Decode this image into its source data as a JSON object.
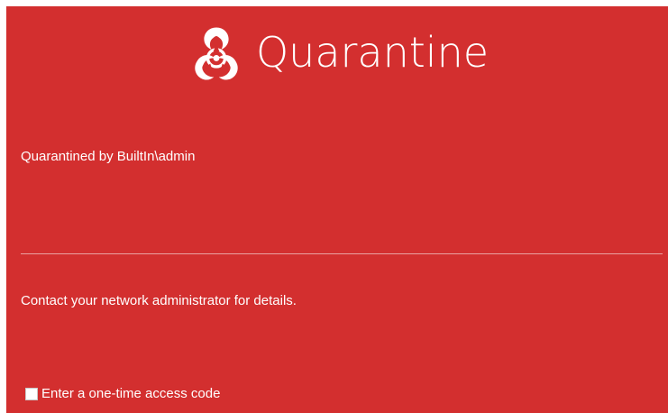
{
  "header": {
    "icon": "biohazard-icon",
    "title": "Quarantine"
  },
  "status": {
    "quarantined_by": "Quarantined by BuiltIn\\admin"
  },
  "message": {
    "contact": "Contact your network administrator for details."
  },
  "access_code": {
    "label": "Enter a one-time access code",
    "checked": false
  },
  "colors": {
    "background": "#d32f2f",
    "text": "#ffffff",
    "divider": "#e9a2a2"
  }
}
